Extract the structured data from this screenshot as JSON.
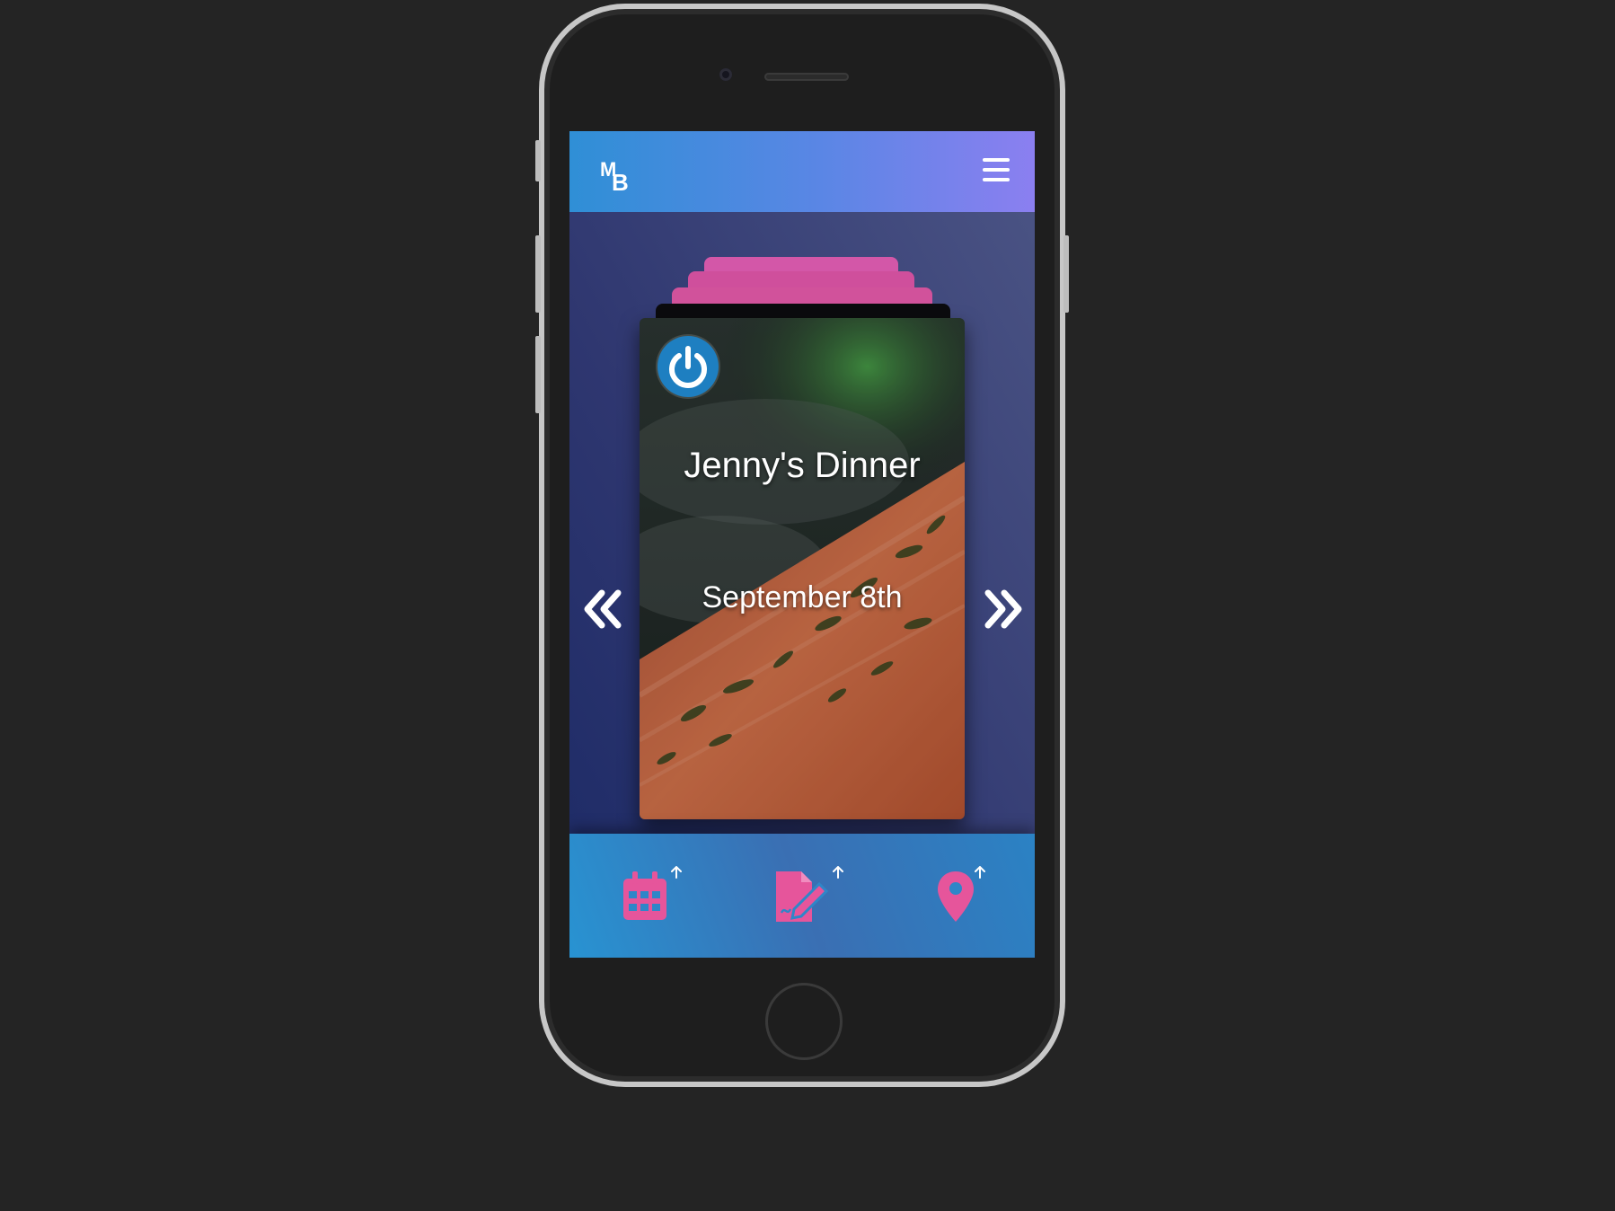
{
  "app": {
    "logo": {
      "m": "M",
      "b": "B"
    },
    "colors": {
      "accent_pink": "#e6559b",
      "header_gradient_start": "#2f8fd6",
      "header_gradient_end": "#8b7ff0",
      "power_blue": "#1e7fc1"
    }
  },
  "header": {
    "menu_icon": "hamburger-icon"
  },
  "card": {
    "title": "Jenny's Dinner",
    "date": "September 8th",
    "icon": "power-icon"
  },
  "carousel": {
    "prev_icon": "double-chevron-left-icon",
    "next_icon": "double-chevron-right-icon"
  },
  "bottom_nav": {
    "items": [
      {
        "icon": "calendar-icon",
        "badge_icon": "arrow-up-icon"
      },
      {
        "icon": "document-edit-icon",
        "badge_icon": "arrow-up-icon"
      },
      {
        "icon": "map-pin-icon",
        "badge_icon": "arrow-up-icon"
      }
    ]
  }
}
